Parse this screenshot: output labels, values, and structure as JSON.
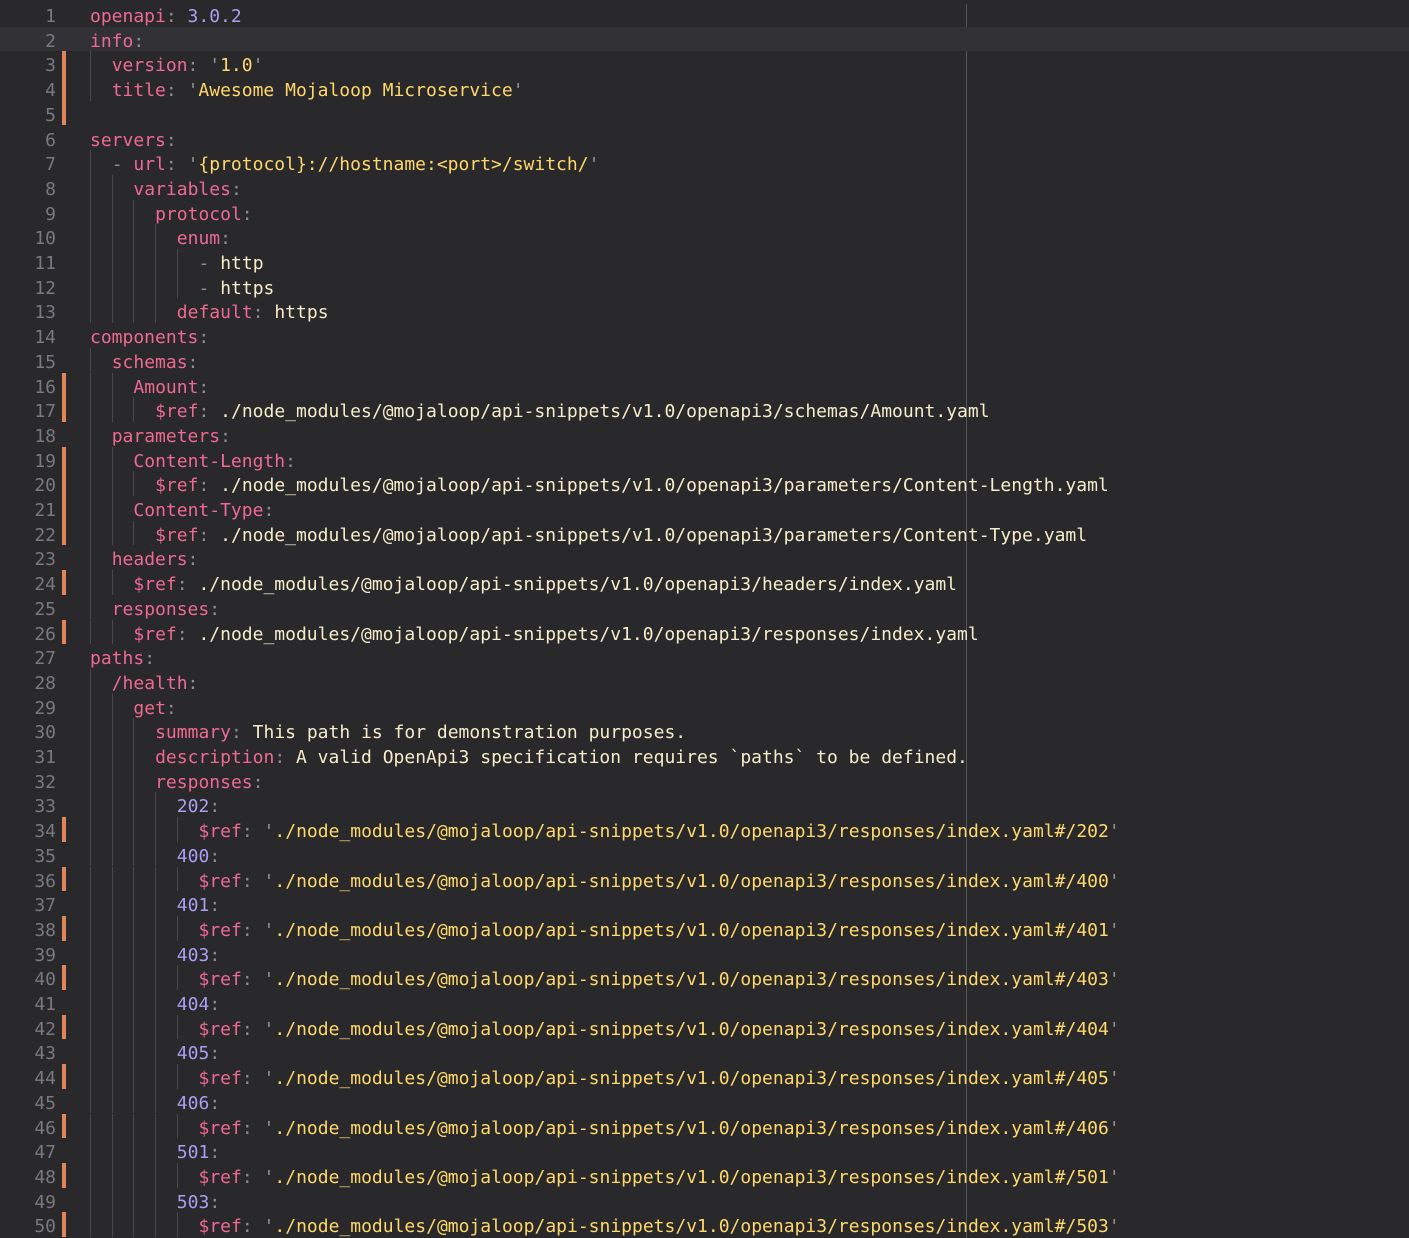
{
  "editor": {
    "language": "yaml",
    "current_line": 2,
    "colors": {
      "background": "#29282b",
      "key": "#ef6a92",
      "string": "#ffd86b",
      "number": "#ab9df2",
      "gutter_marker": "#e0865a"
    },
    "lines": [
      {
        "n": "1",
        "indent": 0,
        "mark": false,
        "tokens": [
          [
            "k",
            "openapi"
          ],
          [
            "p",
            ": "
          ],
          [
            "n",
            "3.0.2"
          ]
        ]
      },
      {
        "n": "2",
        "indent": 0,
        "mark": false,
        "tokens": [
          [
            "k",
            "info"
          ],
          [
            "p",
            ":"
          ]
        ]
      },
      {
        "n": "3",
        "indent": 1,
        "mark": true,
        "tokens": [
          [
            "k",
            "version"
          ],
          [
            "p",
            ": "
          ],
          [
            "q",
            "'"
          ],
          [
            "s",
            "1.0"
          ],
          [
            "q",
            "'"
          ]
        ]
      },
      {
        "n": "4",
        "indent": 1,
        "mark": true,
        "tokens": [
          [
            "k",
            "title"
          ],
          [
            "p",
            ": "
          ],
          [
            "q",
            "'"
          ],
          [
            "s",
            "Awesome Mojaloop Microservice"
          ],
          [
            "q",
            "'"
          ]
        ]
      },
      {
        "n": "5",
        "indent": 0,
        "mark": true,
        "tokens": []
      },
      {
        "n": "6",
        "indent": 0,
        "mark": false,
        "tokens": [
          [
            "k",
            "servers"
          ],
          [
            "p",
            ":"
          ]
        ]
      },
      {
        "n": "7",
        "indent": 1,
        "mark": false,
        "tokens": [
          [
            "p",
            "- "
          ],
          [
            "k",
            "url"
          ],
          [
            "p",
            ": "
          ],
          [
            "q",
            "'"
          ],
          [
            "s",
            "{protocol}://hostname:<port>/switch/"
          ],
          [
            "q",
            "'"
          ]
        ]
      },
      {
        "n": "8",
        "indent": 2,
        "mark": false,
        "tokens": [
          [
            "k",
            "variables"
          ],
          [
            "p",
            ":"
          ]
        ]
      },
      {
        "n": "9",
        "indent": 3,
        "mark": false,
        "tokens": [
          [
            "k",
            "protocol"
          ],
          [
            "p",
            ":"
          ]
        ]
      },
      {
        "n": "10",
        "indent": 4,
        "mark": false,
        "tokens": [
          [
            "k",
            "enum"
          ],
          [
            "p",
            ":"
          ]
        ]
      },
      {
        "n": "11",
        "indent": 5,
        "mark": false,
        "tokens": [
          [
            "p",
            "- "
          ],
          [
            "v",
            "http"
          ]
        ]
      },
      {
        "n": "12",
        "indent": 5,
        "mark": false,
        "tokens": [
          [
            "p",
            "- "
          ],
          [
            "v",
            "https"
          ]
        ]
      },
      {
        "n": "13",
        "indent": 4,
        "mark": false,
        "tokens": [
          [
            "k",
            "default"
          ],
          [
            "p",
            ": "
          ],
          [
            "v",
            "https"
          ]
        ]
      },
      {
        "n": "14",
        "indent": 0,
        "mark": false,
        "tokens": [
          [
            "k",
            "components"
          ],
          [
            "p",
            ":"
          ]
        ]
      },
      {
        "n": "15",
        "indent": 1,
        "mark": false,
        "tokens": [
          [
            "k",
            "schemas"
          ],
          [
            "p",
            ":"
          ]
        ]
      },
      {
        "n": "16",
        "indent": 2,
        "mark": true,
        "tokens": [
          [
            "k",
            "Amount"
          ],
          [
            "p",
            ":"
          ]
        ]
      },
      {
        "n": "17",
        "indent": 3,
        "mark": true,
        "tokens": [
          [
            "k",
            "$ref"
          ],
          [
            "p",
            ": "
          ],
          [
            "v",
            "./node_modules/@mojaloop/api-snippets/v1.0/openapi3/schemas/Amount.yaml"
          ]
        ]
      },
      {
        "n": "18",
        "indent": 1,
        "mark": false,
        "tokens": [
          [
            "k",
            "parameters"
          ],
          [
            "p",
            ":"
          ]
        ]
      },
      {
        "n": "19",
        "indent": 2,
        "mark": true,
        "tokens": [
          [
            "k",
            "Content-Length"
          ],
          [
            "p",
            ":"
          ]
        ]
      },
      {
        "n": "20",
        "indent": 3,
        "mark": true,
        "tokens": [
          [
            "k",
            "$ref"
          ],
          [
            "p",
            ": "
          ],
          [
            "v",
            "./node_modules/@mojaloop/api-snippets/v1.0/openapi3/parameters/Content-Length.yaml"
          ]
        ]
      },
      {
        "n": "21",
        "indent": 2,
        "mark": true,
        "tokens": [
          [
            "k",
            "Content-Type"
          ],
          [
            "p",
            ":"
          ]
        ]
      },
      {
        "n": "22",
        "indent": 3,
        "mark": true,
        "tokens": [
          [
            "k",
            "$ref"
          ],
          [
            "p",
            ": "
          ],
          [
            "v",
            "./node_modules/@mojaloop/api-snippets/v1.0/openapi3/parameters/Content-Type.yaml"
          ]
        ]
      },
      {
        "n": "23",
        "indent": 1,
        "mark": false,
        "tokens": [
          [
            "k",
            "headers"
          ],
          [
            "p",
            ":"
          ]
        ]
      },
      {
        "n": "24",
        "indent": 2,
        "mark": true,
        "tokens": [
          [
            "k",
            "$ref"
          ],
          [
            "p",
            ": "
          ],
          [
            "v",
            "./node_modules/@mojaloop/api-snippets/v1.0/openapi3/headers/index.yaml"
          ]
        ]
      },
      {
        "n": "25",
        "indent": 1,
        "mark": false,
        "tokens": [
          [
            "k",
            "responses"
          ],
          [
            "p",
            ":"
          ]
        ]
      },
      {
        "n": "26",
        "indent": 2,
        "mark": true,
        "tokens": [
          [
            "k",
            "$ref"
          ],
          [
            "p",
            ": "
          ],
          [
            "v",
            "./node_modules/@mojaloop/api-snippets/v1.0/openapi3/responses/index.yaml"
          ]
        ]
      },
      {
        "n": "27",
        "indent": 0,
        "mark": false,
        "tokens": [
          [
            "k",
            "paths"
          ],
          [
            "p",
            ":"
          ]
        ]
      },
      {
        "n": "28",
        "indent": 1,
        "mark": false,
        "tokens": [
          [
            "k",
            "/health"
          ],
          [
            "p",
            ":"
          ]
        ]
      },
      {
        "n": "29",
        "indent": 2,
        "mark": false,
        "tokens": [
          [
            "k",
            "get"
          ],
          [
            "p",
            ":"
          ]
        ]
      },
      {
        "n": "30",
        "indent": 3,
        "mark": false,
        "tokens": [
          [
            "k",
            "summary"
          ],
          [
            "p",
            ": "
          ],
          [
            "v",
            "This path is for demonstration purposes."
          ]
        ]
      },
      {
        "n": "31",
        "indent": 3,
        "mark": false,
        "tokens": [
          [
            "k",
            "description"
          ],
          [
            "p",
            ": "
          ],
          [
            "v",
            "A valid OpenApi3 specification requires `paths` to be defined."
          ]
        ]
      },
      {
        "n": "32",
        "indent": 3,
        "mark": false,
        "tokens": [
          [
            "k",
            "responses"
          ],
          [
            "p",
            ":"
          ]
        ]
      },
      {
        "n": "33",
        "indent": 4,
        "mark": false,
        "tokens": [
          [
            "n",
            "202"
          ],
          [
            "p",
            ":"
          ]
        ]
      },
      {
        "n": "34",
        "indent": 5,
        "mark": true,
        "tokens": [
          [
            "k",
            "$ref"
          ],
          [
            "p",
            ": "
          ],
          [
            "q",
            "'"
          ],
          [
            "s",
            "./node_modules/@mojaloop/api-snippets/v1.0/openapi3/responses/index.yaml#/202"
          ],
          [
            "q",
            "'"
          ]
        ]
      },
      {
        "n": "35",
        "indent": 4,
        "mark": false,
        "tokens": [
          [
            "n",
            "400"
          ],
          [
            "p",
            ":"
          ]
        ]
      },
      {
        "n": "36",
        "indent": 5,
        "mark": true,
        "tokens": [
          [
            "k",
            "$ref"
          ],
          [
            "p",
            ": "
          ],
          [
            "q",
            "'"
          ],
          [
            "s",
            "./node_modules/@mojaloop/api-snippets/v1.0/openapi3/responses/index.yaml#/400"
          ],
          [
            "q",
            "'"
          ]
        ]
      },
      {
        "n": "37",
        "indent": 4,
        "mark": false,
        "tokens": [
          [
            "n",
            "401"
          ],
          [
            "p",
            ":"
          ]
        ]
      },
      {
        "n": "38",
        "indent": 5,
        "mark": true,
        "tokens": [
          [
            "k",
            "$ref"
          ],
          [
            "p",
            ": "
          ],
          [
            "q",
            "'"
          ],
          [
            "s",
            "./node_modules/@mojaloop/api-snippets/v1.0/openapi3/responses/index.yaml#/401"
          ],
          [
            "q",
            "'"
          ]
        ]
      },
      {
        "n": "39",
        "indent": 4,
        "mark": false,
        "tokens": [
          [
            "n",
            "403"
          ],
          [
            "p",
            ":"
          ]
        ]
      },
      {
        "n": "40",
        "indent": 5,
        "mark": true,
        "tokens": [
          [
            "k",
            "$ref"
          ],
          [
            "p",
            ": "
          ],
          [
            "q",
            "'"
          ],
          [
            "s",
            "./node_modules/@mojaloop/api-snippets/v1.0/openapi3/responses/index.yaml#/403"
          ],
          [
            "q",
            "'"
          ]
        ]
      },
      {
        "n": "41",
        "indent": 4,
        "mark": false,
        "tokens": [
          [
            "n",
            "404"
          ],
          [
            "p",
            ":"
          ]
        ]
      },
      {
        "n": "42",
        "indent": 5,
        "mark": true,
        "tokens": [
          [
            "k",
            "$ref"
          ],
          [
            "p",
            ": "
          ],
          [
            "q",
            "'"
          ],
          [
            "s",
            "./node_modules/@mojaloop/api-snippets/v1.0/openapi3/responses/index.yaml#/404"
          ],
          [
            "q",
            "'"
          ]
        ]
      },
      {
        "n": "43",
        "indent": 4,
        "mark": false,
        "tokens": [
          [
            "n",
            "405"
          ],
          [
            "p",
            ":"
          ]
        ]
      },
      {
        "n": "44",
        "indent": 5,
        "mark": true,
        "tokens": [
          [
            "k",
            "$ref"
          ],
          [
            "p",
            ": "
          ],
          [
            "q",
            "'"
          ],
          [
            "s",
            "./node_modules/@mojaloop/api-snippets/v1.0/openapi3/responses/index.yaml#/405"
          ],
          [
            "q",
            "'"
          ]
        ]
      },
      {
        "n": "45",
        "indent": 4,
        "mark": false,
        "tokens": [
          [
            "n",
            "406"
          ],
          [
            "p",
            ":"
          ]
        ]
      },
      {
        "n": "46",
        "indent": 5,
        "mark": true,
        "tokens": [
          [
            "k",
            "$ref"
          ],
          [
            "p",
            ": "
          ],
          [
            "q",
            "'"
          ],
          [
            "s",
            "./node_modules/@mojaloop/api-snippets/v1.0/openapi3/responses/index.yaml#/406"
          ],
          [
            "q",
            "'"
          ]
        ]
      },
      {
        "n": "47",
        "indent": 4,
        "mark": false,
        "tokens": [
          [
            "n",
            "501"
          ],
          [
            "p",
            ":"
          ]
        ]
      },
      {
        "n": "48",
        "indent": 5,
        "mark": true,
        "tokens": [
          [
            "k",
            "$ref"
          ],
          [
            "p",
            ": "
          ],
          [
            "q",
            "'"
          ],
          [
            "s",
            "./node_modules/@mojaloop/api-snippets/v1.0/openapi3/responses/index.yaml#/501"
          ],
          [
            "q",
            "'"
          ]
        ]
      },
      {
        "n": "49",
        "indent": 4,
        "mark": false,
        "tokens": [
          [
            "n",
            "503"
          ],
          [
            "p",
            ":"
          ]
        ]
      },
      {
        "n": "50",
        "indent": 5,
        "mark": true,
        "tokens": [
          [
            "k",
            "$ref"
          ],
          [
            "p",
            ": "
          ],
          [
            "q",
            "'"
          ],
          [
            "s",
            "./node_modules/@mojaloop/api-snippets/v1.0/openapi3/responses/index.yaml#/503"
          ],
          [
            "q",
            "'"
          ]
        ]
      }
    ]
  }
}
